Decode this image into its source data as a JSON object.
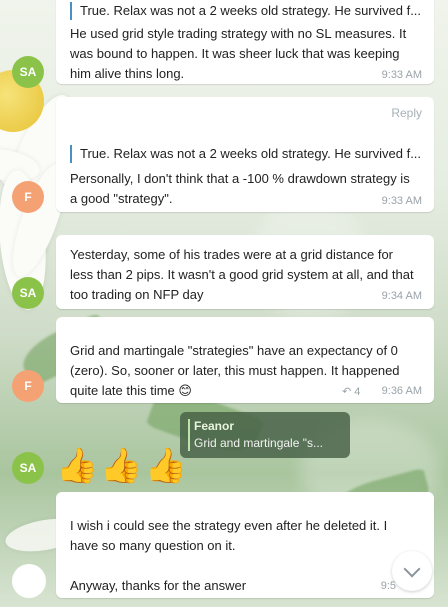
{
  "colors": {
    "sa_avatar": "#8bc34a",
    "f_avatar": "#f4a274",
    "quote_bar": "#4a90c2",
    "bubble": "#ffffff"
  },
  "messages": [
    {
      "quote": "True. Relax was not a 2 weeks old strategy. He survived f...",
      "lines": [
        "He used grid style trading strategy with no SL measures. It",
        "was bound to happen. It was sheer luck that was keeping",
        "him alive thins long."
      ],
      "time": "9:33 AM",
      "avatar": "SA"
    },
    {
      "reply_label": "Reply",
      "quote": "True. Relax was not a 2 weeks old strategy. He survived f...",
      "lines": [
        "Personally, I don't think that a -100 % drawdown strategy is",
        "a good \"strategy\"."
      ],
      "time": "9:33 AM",
      "avatar": "F"
    },
    {
      "lines": [
        "Yesterday, some of his trades were at a grid distance for",
        "less than 2 pips. It wasn't a good grid system at all, and that",
        "too trading on NFP day"
      ],
      "time": "9:34 AM",
      "avatar": "SA"
    },
    {
      "lines": [
        "Grid and martingale \"strategies\" have an expectancy of 0",
        "(zero). So, sooner or later, this must happen. It happened",
        "quite late this time 😊"
      ],
      "views": "4",
      "time": "9:36 AM",
      "avatar": "F"
    },
    {
      "reply_author": "Feanor",
      "reply_text": "Grid and martingale \"s...",
      "emoji": "👍👍👍",
      "avatar": "SA"
    },
    {
      "lines": [
        "I wish i could see the strategy even after he deleted it. I",
        "have so many question on it.",
        "",
        "Anyway, thanks for the answer"
      ],
      "time": "9:5"
    }
  ]
}
